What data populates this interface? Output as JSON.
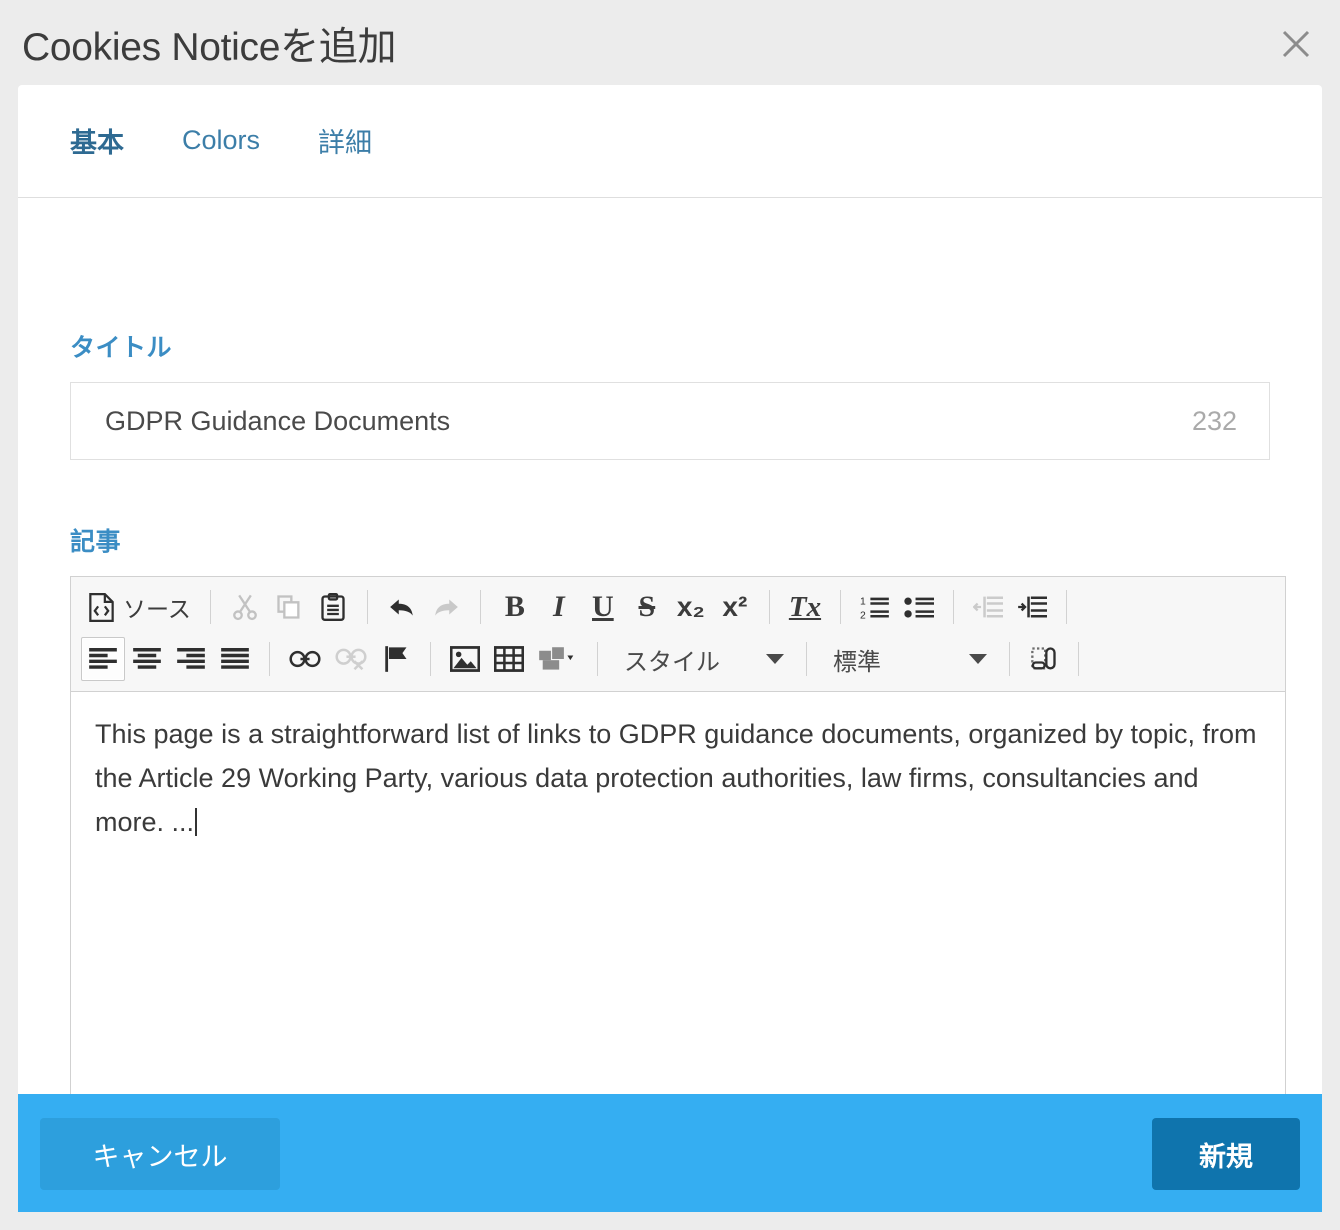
{
  "modal": {
    "title": "Cookies Noticeを追加",
    "close_icon": "close-icon"
  },
  "tabs": [
    {
      "label": "基本",
      "active": true
    },
    {
      "label": "Colors",
      "active": false
    },
    {
      "label": "詳細",
      "active": false
    }
  ],
  "fields": {
    "title": {
      "label": "タイトル",
      "value": "GDPR Guidance Documents",
      "placeholder": "",
      "counter": "232"
    },
    "body": {
      "label": "記事",
      "text": "This page is a straightforward list of links to GDPR guidance documents, organized by topic, from the Article 29 Working Party, various data protection authorities, law firms, consultancies and more. ..."
    }
  },
  "toolbar": {
    "row1": [
      {
        "name": "source-icon",
        "label": "ソース",
        "state": "enabled"
      },
      {
        "name": "separator",
        "label": "",
        "state": "sep"
      },
      {
        "name": "cut-icon",
        "label": "",
        "state": "disabled"
      },
      {
        "name": "copy-icon",
        "label": "",
        "state": "disabled"
      },
      {
        "name": "paste-icon",
        "label": "",
        "state": "enabled"
      },
      {
        "name": "separator",
        "label": "",
        "state": "sep"
      },
      {
        "name": "undo-icon",
        "label": "",
        "state": "enabled"
      },
      {
        "name": "redo-icon",
        "label": "",
        "state": "disabled"
      },
      {
        "name": "separator",
        "label": "",
        "state": "sep"
      },
      {
        "name": "bold-icon",
        "label": "B",
        "state": "enabled"
      },
      {
        "name": "italic-icon",
        "label": "I",
        "state": "enabled"
      },
      {
        "name": "underline-icon",
        "label": "U",
        "state": "enabled"
      },
      {
        "name": "strikethrough-icon",
        "label": "S",
        "state": "enabled"
      },
      {
        "name": "subscript-icon",
        "label": "x₂",
        "state": "enabled"
      },
      {
        "name": "superscript-icon",
        "label": "x²",
        "state": "enabled"
      },
      {
        "name": "separator",
        "label": "",
        "state": "sep"
      },
      {
        "name": "remove-format-icon",
        "label": "Tx",
        "state": "enabled"
      },
      {
        "name": "separator",
        "label": "",
        "state": "sep"
      },
      {
        "name": "numbered-list-icon",
        "label": "",
        "state": "enabled"
      },
      {
        "name": "bulleted-list-icon",
        "label": "",
        "state": "enabled"
      },
      {
        "name": "separator",
        "label": "",
        "state": "sep"
      },
      {
        "name": "outdent-icon",
        "label": "",
        "state": "disabled"
      },
      {
        "name": "indent-icon",
        "label": "",
        "state": "enabled"
      },
      {
        "name": "separator",
        "label": "",
        "state": "sep"
      }
    ],
    "row2": [
      {
        "name": "align-left-icon",
        "label": "",
        "state": "pressed"
      },
      {
        "name": "align-center-icon",
        "label": "",
        "state": "enabled"
      },
      {
        "name": "align-right-icon",
        "label": "",
        "state": "enabled"
      },
      {
        "name": "align-justify-icon",
        "label": "",
        "state": "enabled"
      },
      {
        "name": "separator",
        "label": "",
        "state": "sep"
      },
      {
        "name": "link-icon",
        "label": "",
        "state": "enabled"
      },
      {
        "name": "unlink-icon",
        "label": "",
        "state": "disabled"
      },
      {
        "name": "anchor-flag-icon",
        "label": "",
        "state": "enabled"
      },
      {
        "name": "separator",
        "label": "",
        "state": "sep"
      },
      {
        "name": "image-icon",
        "label": "",
        "state": "enabled"
      },
      {
        "name": "table-icon",
        "label": "",
        "state": "enabled"
      },
      {
        "name": "templates-icon",
        "label": "",
        "state": "enabled"
      },
      {
        "name": "separator",
        "label": "",
        "state": "sep"
      }
    ],
    "style_dropdown": "スタイル",
    "format_dropdown": "標準",
    "show_blocks_icon": "show-blocks-icon"
  },
  "footer": {
    "cancel_label": "キャンセル",
    "submit_label": "新規"
  },
  "colors": {
    "page_bg": "#ececec",
    "modal_bg": "#ffffff",
    "accent": "#3b8dc4",
    "tab_link": "#3c7ea8",
    "footer_bg": "#35aef2",
    "cancel_bg": "#2d9fdd",
    "submit_bg": "#0f74ad",
    "counter_text": "#aaaaaa",
    "body_text": "#3a3a3a"
  }
}
